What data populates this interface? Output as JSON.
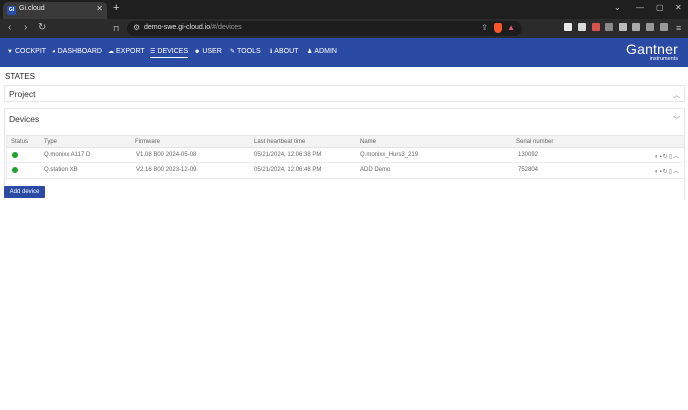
{
  "browser": {
    "tab_title": "Gi.cloud",
    "tab_favicon_text": "GI",
    "url_host": "demo-swe.gi-cloud.io",
    "url_path": "/#/devices"
  },
  "nav": {
    "items": [
      {
        "label": "COCKPIT",
        "icon": "cockpit-icon"
      },
      {
        "label": "DASHBOARD",
        "icon": "dashboard-icon"
      },
      {
        "label": "EXPORT",
        "icon": "cloud-export-icon"
      },
      {
        "label": "DEVICES",
        "icon": "devices-icon",
        "active": true
      },
      {
        "label": "USER",
        "icon": "user-group-icon"
      },
      {
        "label": "TOOLS",
        "icon": "wrench-icon"
      },
      {
        "label": "ABOUT",
        "icon": "info-icon"
      },
      {
        "label": "ADMIN",
        "icon": "admin-icon"
      }
    ],
    "brand_main": "Gantner",
    "brand_sub": "instruments",
    "color": "#2a4aa4"
  },
  "page": {
    "title": "STATES",
    "project_label": "Project",
    "devices_label": "Devices"
  },
  "table": {
    "columns": [
      "Status",
      "Type",
      "Firmware",
      "Last heartbeat time",
      "Name",
      "Serial number"
    ],
    "rows": [
      {
        "status": "online",
        "type": "Q.monixx A117 D",
        "firmware": "V1.08 B00 2024-05-08",
        "heartbeat": "05/21/2024, 12:06:38 PM",
        "name": "Q.monixx_Hurs3_219",
        "serial": "130092"
      },
      {
        "status": "online",
        "type": "Q.station XB",
        "firmware": "V2.16 B00 2023-12-09",
        "heartbeat": "05/21/2024, 12:06:48 PM",
        "name": "ADD Demo",
        "serial": "752804"
      }
    ],
    "status_color": "#22a02d"
  },
  "actions": {
    "add_device": "Add device"
  }
}
